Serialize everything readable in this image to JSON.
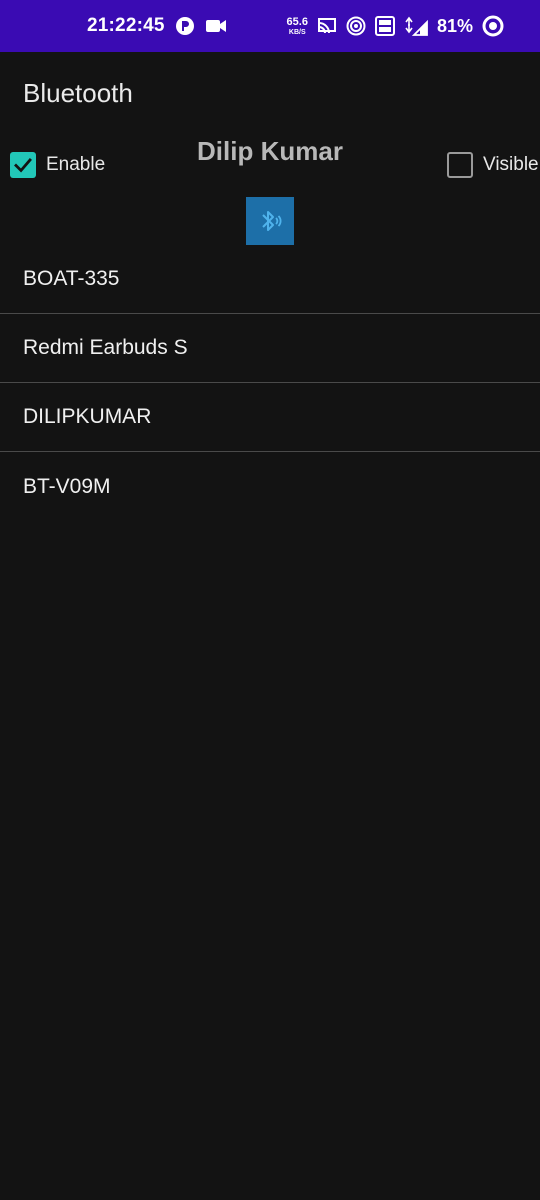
{
  "status_bar": {
    "time": "21:22:45",
    "net_speed_value": "65.6",
    "net_speed_unit": "KB/S",
    "battery_percent": "81%",
    "colors": {
      "background": "#3a0bb3"
    }
  },
  "app": {
    "title": "Bluetooth",
    "device_name": "Dilip Kumar"
  },
  "controls": {
    "enable": {
      "label": "Enable",
      "checked": true
    },
    "visible": {
      "label": "Visible",
      "checked": false
    },
    "bluetooth_button_icon": "bluetooth-icon"
  },
  "devices": [
    "BOAT-335",
    "Redmi Earbuds S",
    "DILIPKUMAR",
    "BT-V09M"
  ],
  "colors": {
    "background": "#131313",
    "accent_checkbox": "#22c7b8",
    "bluetooth_button": "#1d6fa8"
  }
}
